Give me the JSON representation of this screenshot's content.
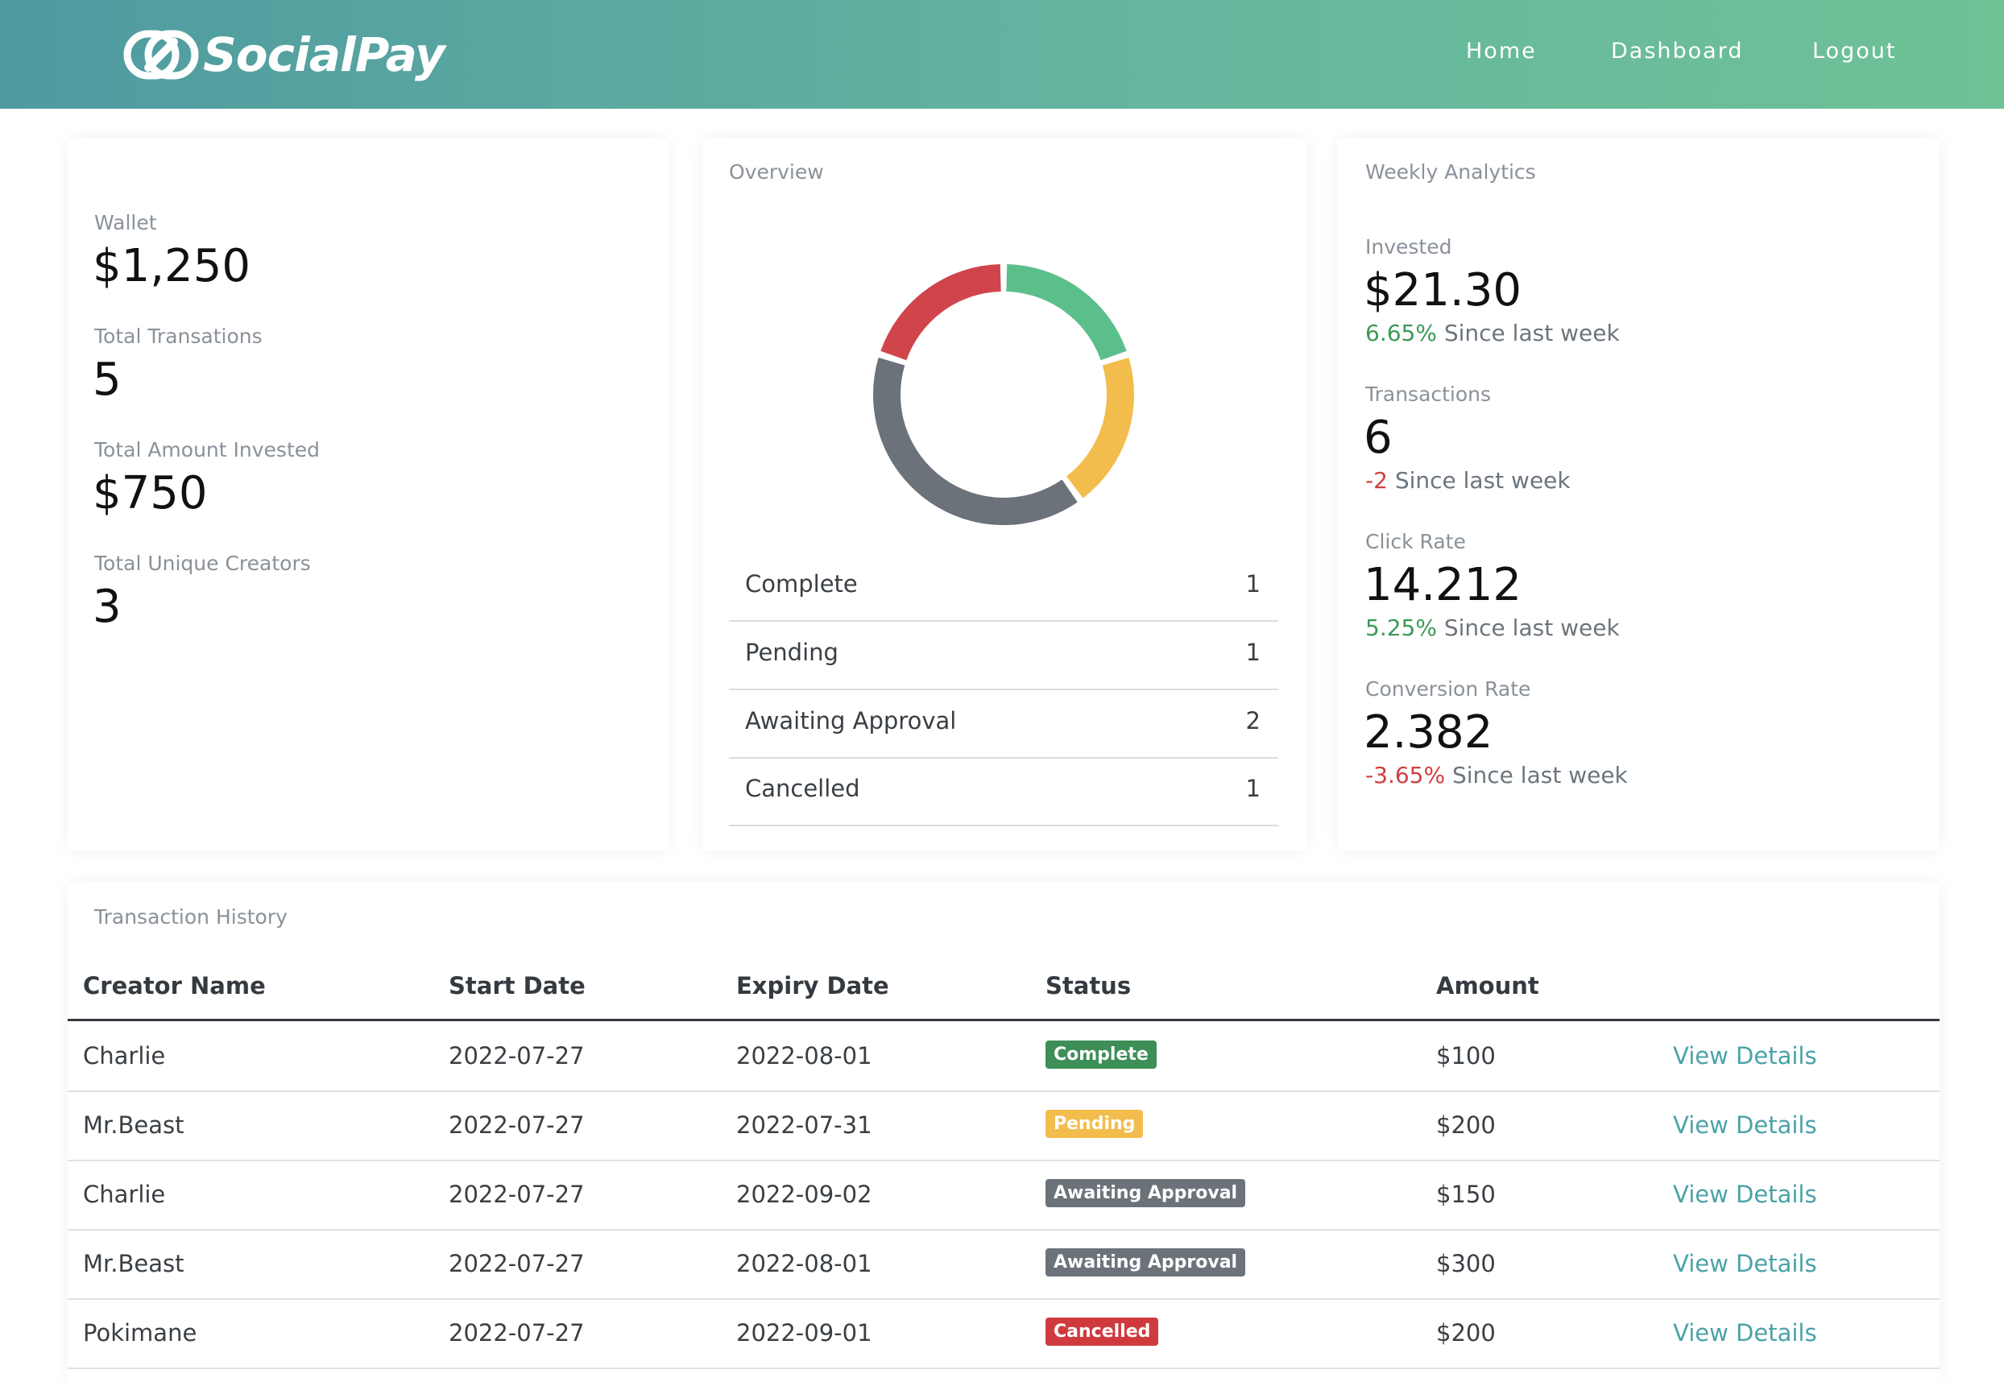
{
  "nav": {
    "brand": "SocialPay",
    "links": [
      "Home",
      "Dashboard",
      "Logout"
    ]
  },
  "summary": {
    "items": [
      {
        "label": "Wallet",
        "value": "$1,250"
      },
      {
        "label": "Total Transations",
        "value": "5"
      },
      {
        "label": "Total Amount Invested",
        "value": "$750"
      },
      {
        "label": "Total Unique Creators",
        "value": "3"
      }
    ]
  },
  "overview": {
    "title": "Overview",
    "items": [
      {
        "label": "Complete",
        "count": "1",
        "color": "#5bbf8c"
      },
      {
        "label": "Pending",
        "count": "1",
        "color": "#f2bd4c"
      },
      {
        "label": "Awaiting Approval",
        "count": "2",
        "color": "#6c727a"
      },
      {
        "label": "Cancelled",
        "count": "1",
        "color": "#d0454b"
      }
    ]
  },
  "weekly": {
    "title": "Weekly Analytics",
    "items": [
      {
        "label": "Invested",
        "value": "$21.30",
        "delta": "6.65%",
        "trend": "up",
        "suffix": "Since last week"
      },
      {
        "label": "Transactions",
        "value": "6",
        "delta": "-2",
        "trend": "down",
        "suffix": "Since last week"
      },
      {
        "label": "Click Rate",
        "value": "14.212",
        "delta": "5.25%",
        "trend": "up",
        "suffix": "Since last week"
      },
      {
        "label": "Conversion Rate",
        "value": "2.382",
        "delta": "-3.65%",
        "trend": "down",
        "suffix": "Since last week"
      }
    ]
  },
  "history": {
    "title": "Transaction History",
    "columns": [
      "Creator Name",
      "Start Date",
      "Expiry Date",
      "Status",
      "Amount"
    ],
    "link_label": "View Details",
    "rows": [
      {
        "creator": "Charlie",
        "start": "2022-07-27",
        "expiry": "2022-08-01",
        "status": "Complete",
        "amount": "$100"
      },
      {
        "creator": "Mr.Beast",
        "start": "2022-07-27",
        "expiry": "2022-07-31",
        "status": "Pending",
        "amount": "$200"
      },
      {
        "creator": "Charlie",
        "start": "2022-07-27",
        "expiry": "2022-09-02",
        "status": "Awaiting Approval",
        "amount": "$150"
      },
      {
        "creator": "Mr.Beast",
        "start": "2022-07-27",
        "expiry": "2022-08-01",
        "status": "Awaiting Approval",
        "amount": "$300"
      },
      {
        "creator": "Pokimane",
        "start": "2022-07-27",
        "expiry": "2022-09-01",
        "status": "Cancelled",
        "amount": "$200"
      }
    ]
  },
  "colors": {
    "complete": "#3e8e58",
    "pending": "#f2bd4c",
    "awaiting": "#6c727a",
    "cancelled": "#cf3a3f",
    "link": "#4aa3a8"
  }
}
